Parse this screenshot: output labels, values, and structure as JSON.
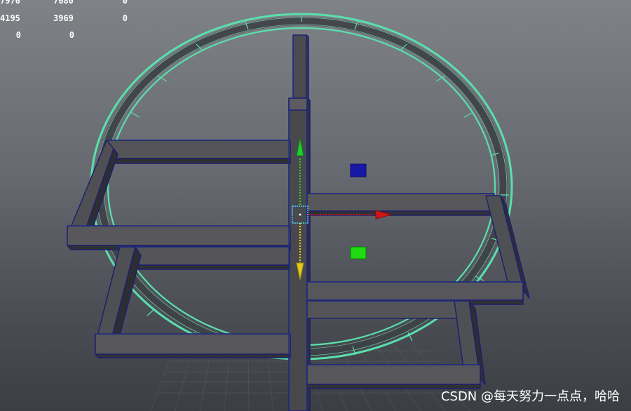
{
  "hud": {
    "rows": [
      [
        "7976",
        "7680",
        "0"
      ],
      [
        "4195",
        "3969",
        "0"
      ],
      [
        "0",
        "0"
      ]
    ]
  },
  "watermark": {
    "text": "CSDN @每天努力一点点，哈哈"
  }
}
